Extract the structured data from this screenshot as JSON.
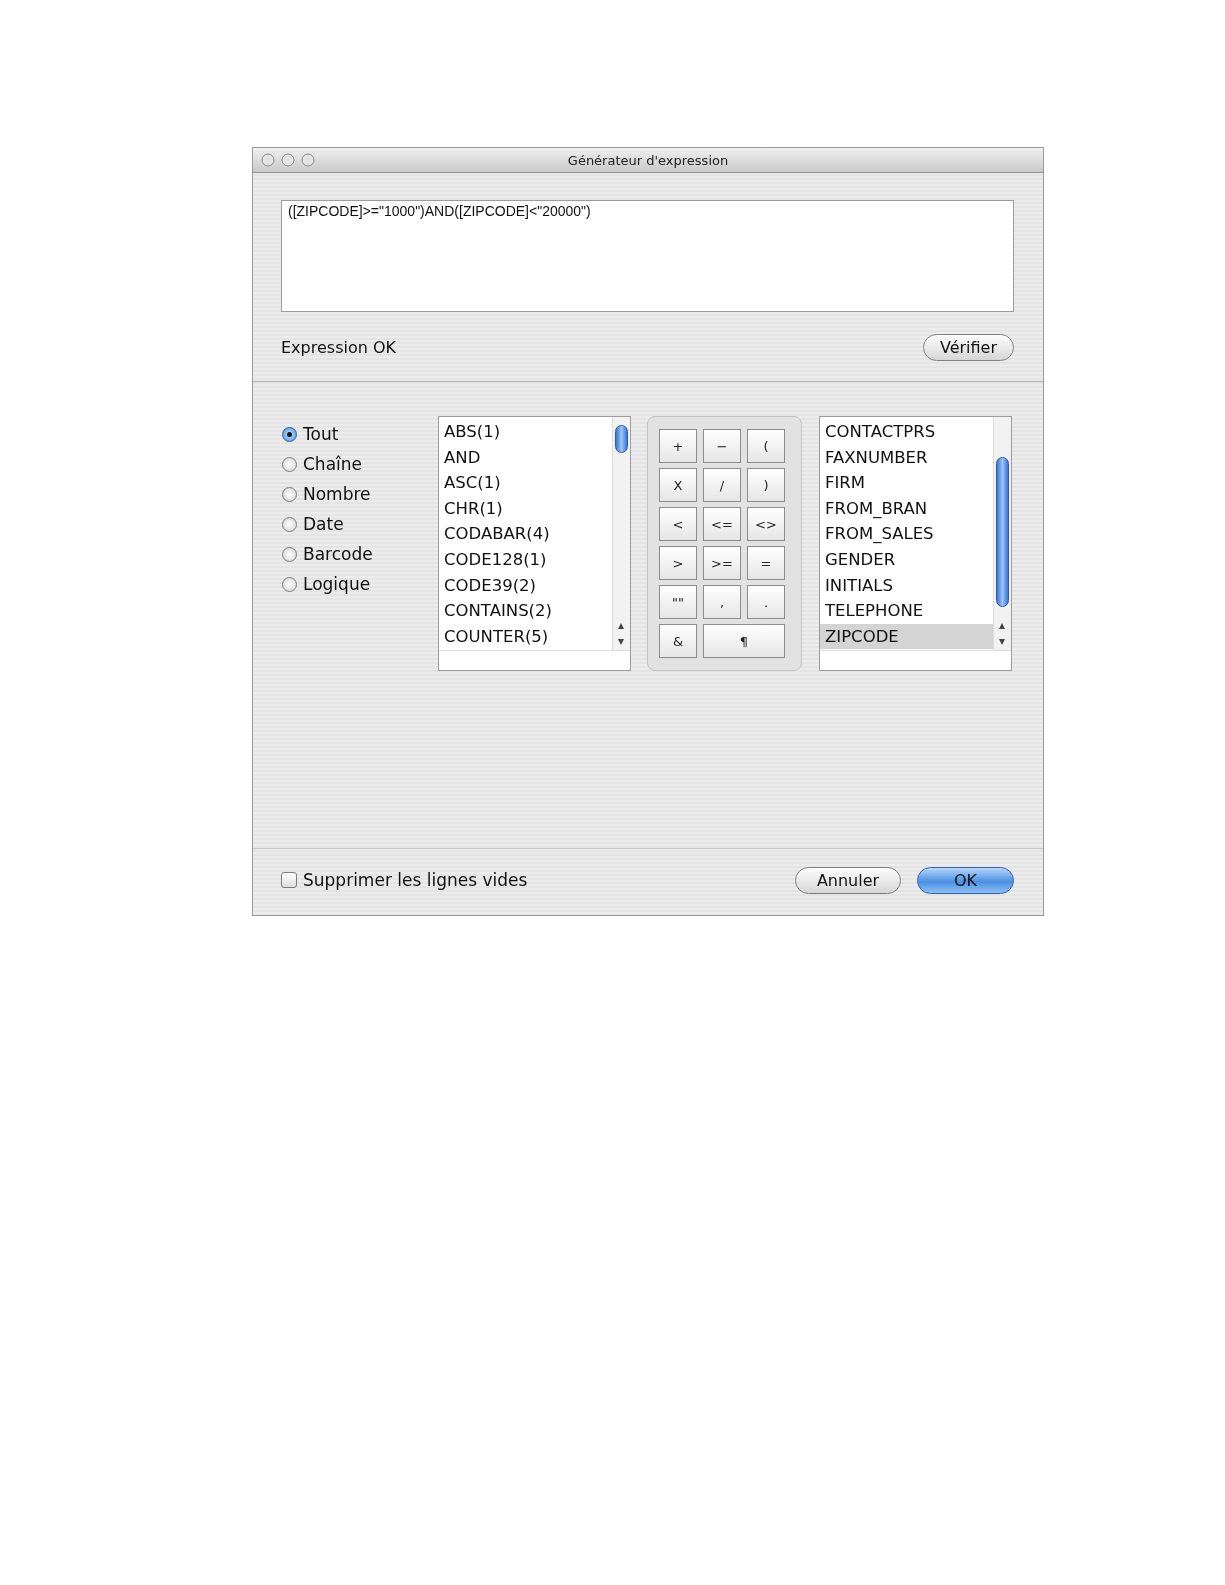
{
  "window": {
    "title": "Générateur d'expression"
  },
  "expression": {
    "value": "([ZIPCODE]>=\"1000\")AND([ZIPCODE]<\"20000\")"
  },
  "status": "Expression OK",
  "verify_button": "Vérifier",
  "filters": [
    {
      "label": "Tout",
      "selected": true
    },
    {
      "label": "Chaîne",
      "selected": false
    },
    {
      "label": "Nombre",
      "selected": false
    },
    {
      "label": "Date",
      "selected": false
    },
    {
      "label": "Barcode",
      "selected": false
    },
    {
      "label": "Logique",
      "selected": false
    }
  ],
  "functions": [
    "ABS(1)",
    "AND",
    "ASC(1)",
    "CHR(1)",
    "CODABAR(4)",
    "CODE128(1)",
    "CODE39(2)",
    "CONTAINS(2)",
    "COUNTER(5)"
  ],
  "keypad": [
    {
      "label": "+",
      "kind": "key"
    },
    {
      "label": "−",
      "kind": "key"
    },
    {
      "label": "(",
      "kind": "key"
    },
    {
      "label": "X",
      "kind": "key"
    },
    {
      "label": "/",
      "kind": "key"
    },
    {
      "label": ")",
      "kind": "key"
    },
    {
      "label": "<",
      "kind": "key"
    },
    {
      "label": "<=",
      "kind": "key"
    },
    {
      "label": "<>",
      "kind": "key"
    },
    {
      "label": ">",
      "kind": "key"
    },
    {
      "label": ">=",
      "kind": "key"
    },
    {
      "label": "=",
      "kind": "key"
    },
    {
      "label": "\"\"",
      "kind": "key"
    },
    {
      "label": ",",
      "kind": "key"
    },
    {
      "label": ".",
      "kind": "key"
    },
    {
      "label": "&",
      "kind": "key"
    },
    {
      "label": "¶",
      "kind": "wide"
    }
  ],
  "fields": [
    {
      "label": "CONTACTPRS",
      "selected": false
    },
    {
      "label": "FAXNUMBER",
      "selected": false
    },
    {
      "label": "FIRM",
      "selected": false
    },
    {
      "label": "FROM_BRAN",
      "selected": false
    },
    {
      "label": "FROM_SALES",
      "selected": false
    },
    {
      "label": "GENDER",
      "selected": false
    },
    {
      "label": "INITIALS",
      "selected": false
    },
    {
      "label": "TELEPHONE",
      "selected": false
    },
    {
      "label": "ZIPCODE",
      "selected": true
    }
  ],
  "suppress_empty": {
    "label": "Supprimer les lignes vides",
    "checked": false
  },
  "buttons": [
    {
      "label": "Annuler",
      "kind": "cancel"
    },
    {
      "label": "OK",
      "kind": "default"
    }
  ]
}
